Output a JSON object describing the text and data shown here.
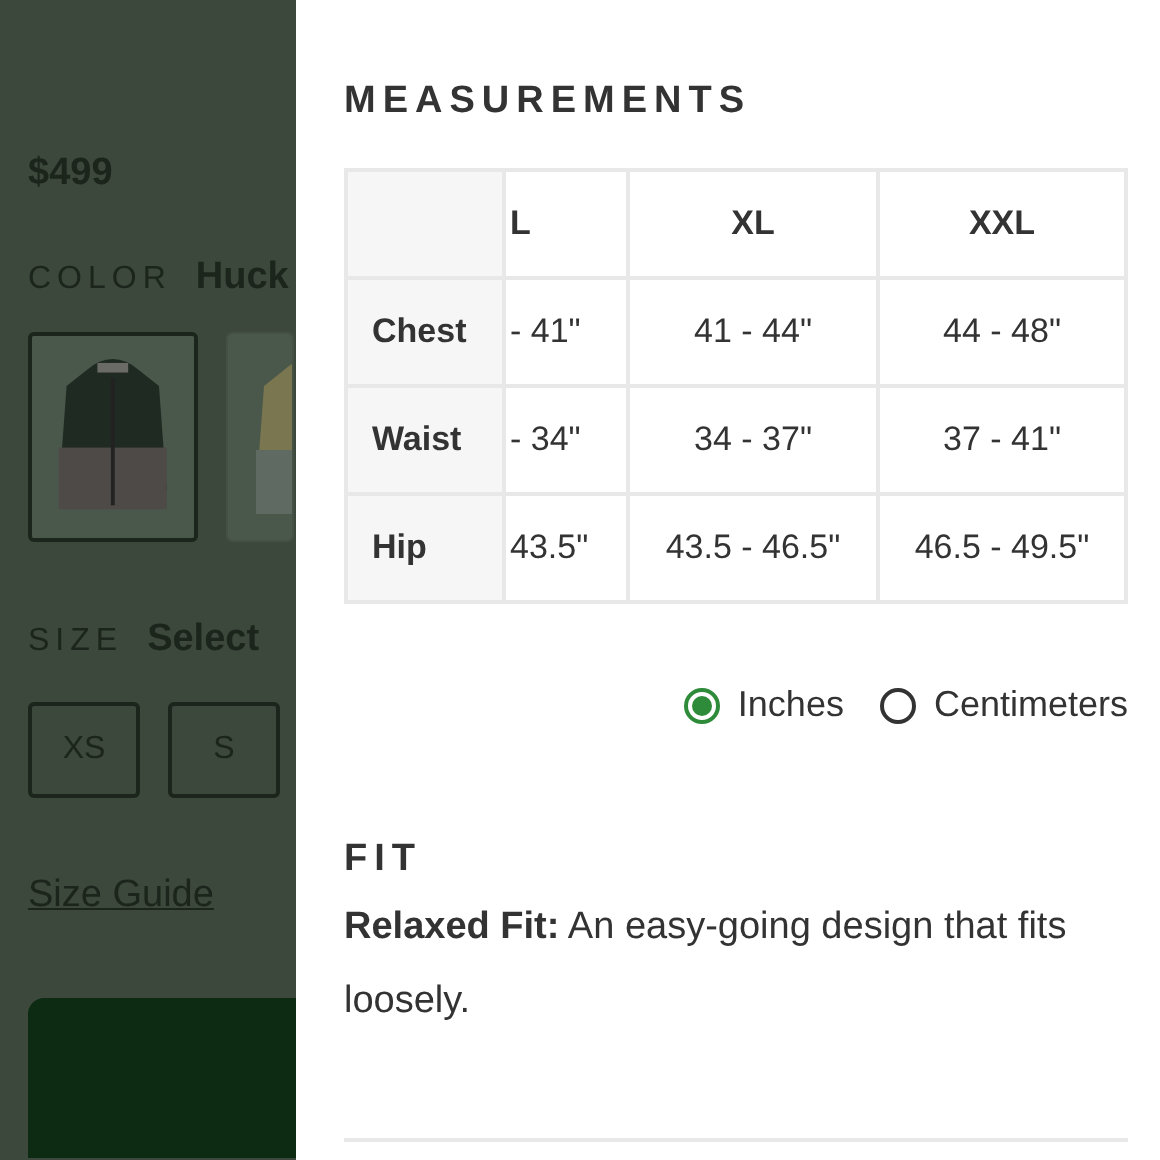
{
  "product": {
    "price": "$499",
    "color_label": "COLOR",
    "color_value": "Huck",
    "swatches": [
      {
        "kind": "picture",
        "selected": true
      },
      {
        "kind": "picture",
        "selected": false
      }
    ],
    "size_label": "SIZE",
    "size_value": "Select",
    "sizes": [
      "XS",
      "S"
    ],
    "size_guide": "Size Guide"
  },
  "measurements": {
    "title": "MEASUREMENTS",
    "columns": [
      "L",
      "XL",
      "XXL"
    ],
    "rows": [
      {
        "label": "Chest",
        "values": [
          "- 41\"",
          "41 - 44\"",
          "44 - 48\""
        ]
      },
      {
        "label": "Waist",
        "values": [
          "- 34\"",
          "34 - 37\"",
          "37 - 41\""
        ]
      },
      {
        "label": "Hip",
        "values": [
          "43.5\"",
          "43.5 - 46.5\"",
          "46.5 - 49.5\""
        ]
      }
    ],
    "units": [
      {
        "label": "Inches",
        "selected": true
      },
      {
        "label": "Centimeters",
        "selected": false
      }
    ]
  },
  "fit": {
    "title": "FIT",
    "text": "**Relaxed Fit:** An easy-going design that fits loosely."
  }
}
